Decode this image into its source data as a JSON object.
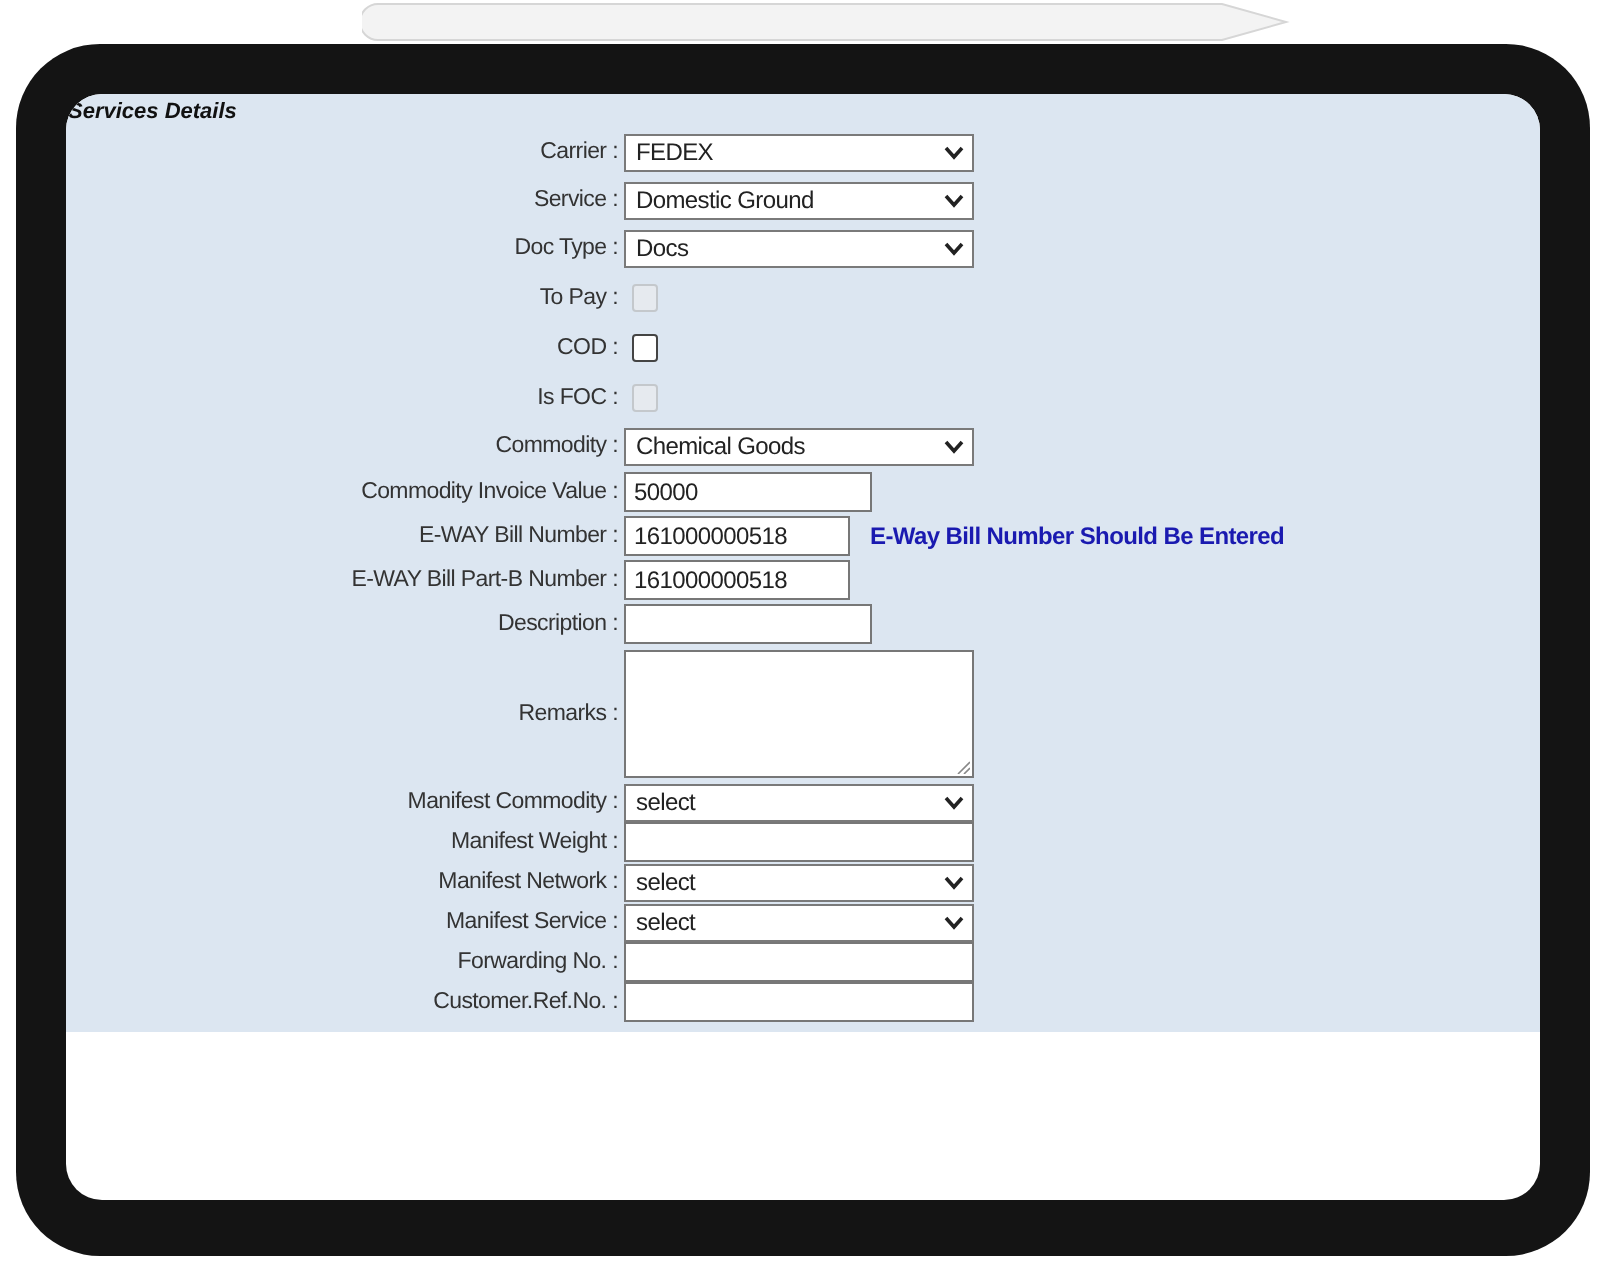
{
  "section": {
    "title": "Services Details"
  },
  "fields": [
    {
      "kind": "select",
      "label": "Carrier :",
      "value": "FEDEX"
    },
    {
      "kind": "select",
      "label": "Service :",
      "value": "Domestic Ground"
    },
    {
      "kind": "select",
      "label": "Doc Type :",
      "value": "Docs"
    },
    {
      "kind": "checkbox",
      "label": "To Pay :",
      "checked": false,
      "disabled": true
    },
    {
      "kind": "checkbox",
      "label": "COD :",
      "checked": false,
      "disabled": false
    },
    {
      "kind": "checkbox",
      "label": "Is FOC :",
      "checked": false,
      "disabled": true
    },
    {
      "kind": "select",
      "label": "Commodity :",
      "value": "Chemical Goods"
    },
    {
      "kind": "text",
      "label": "Commodity Invoice Value :",
      "value": "50000"
    },
    {
      "kind": "text",
      "label": "E-WAY Bill Number :",
      "value": "161000000518",
      "note": "E-Way Bill Number Should Be Entered"
    },
    {
      "kind": "text",
      "label": "E-WAY Bill Part-B Number :",
      "value": "161000000518"
    },
    {
      "kind": "text",
      "label": "Description :"
    },
    {
      "kind": "textarea",
      "label": "Remarks :"
    },
    {
      "kind": "select",
      "label": "Manifest Commodity :",
      "value": "select"
    },
    {
      "kind": "text",
      "label": "Manifest Weight :"
    },
    {
      "kind": "select",
      "label": "Manifest Network :",
      "value": "select"
    },
    {
      "kind": "select",
      "label": "Manifest Service :",
      "value": "select"
    },
    {
      "kind": "text",
      "label": "Forwarding No. :"
    },
    {
      "kind": "text",
      "label": "Customer.Ref.No. :"
    }
  ]
}
